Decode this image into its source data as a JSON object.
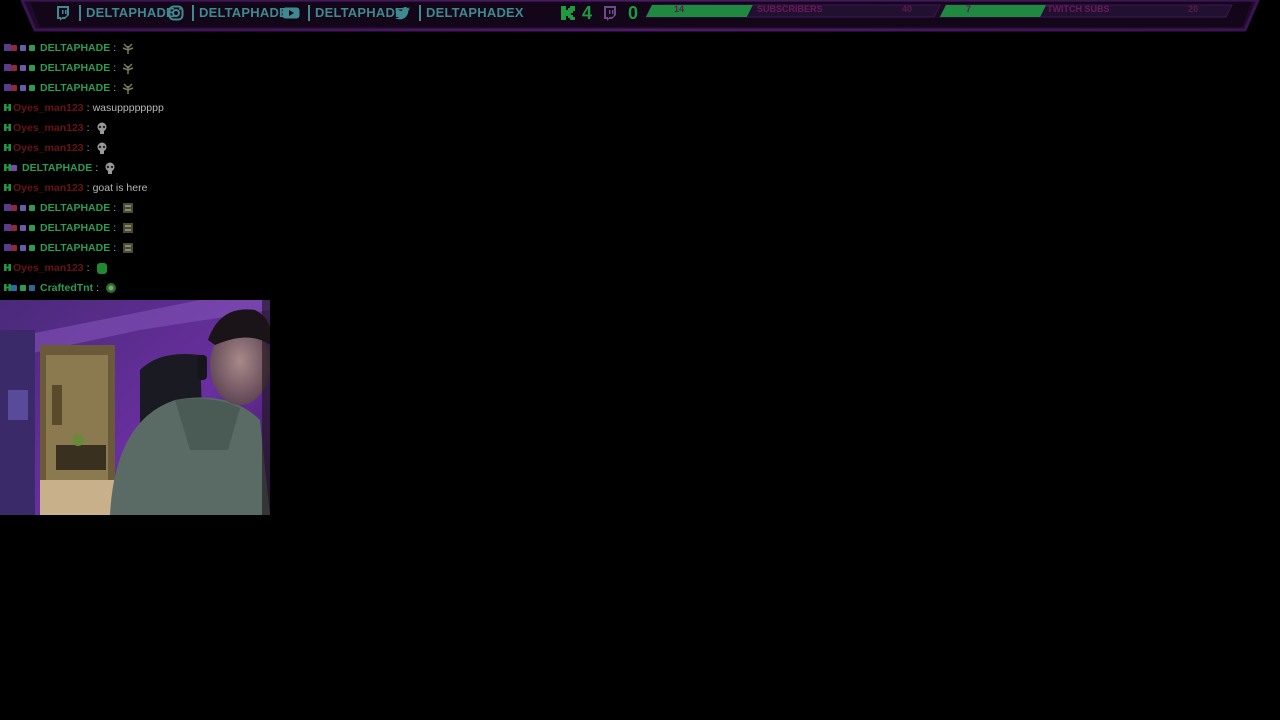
{
  "overlay": {
    "socials": [
      {
        "platform": "twitch",
        "icon": "twitch-icon",
        "handle": "DELTAPHADE"
      },
      {
        "platform": "instagram",
        "icon": "instagram-icon",
        "handle": "DELTAPHADE"
      },
      {
        "platform": "youtube",
        "icon": "youtube-icon",
        "handle": "DELTAPHADE"
      },
      {
        "platform": "twitter",
        "icon": "twitter-icon",
        "handle": "DELTAPHADEX"
      }
    ],
    "counters": [
      {
        "icon": "kick-icon",
        "value": "4"
      },
      {
        "icon": "twitch-icon",
        "value": "0"
      }
    ],
    "goals": [
      {
        "label": "SUBSCRIBERS",
        "current": "14",
        "target": "40",
        "fill": 0.35
      },
      {
        "label": "TWITCH SUBS",
        "current": "7",
        "target": "20",
        "fill": 0.35
      }
    ],
    "colors": {
      "accent_purple": "#5b1f7a",
      "social_text": "#3f8a8f",
      "bar_green": "#1f8a3f",
      "username_green": "#2d9b52",
      "username_red": "#6b1213"
    }
  },
  "chat": {
    "messages": [
      {
        "platform": "twitch",
        "user": "DELTAPHADE",
        "style": "delta",
        "text": "",
        "emote": "plant-emote"
      },
      {
        "platform": "twitch",
        "user": "DELTAPHADE",
        "style": "delta",
        "text": "",
        "emote": "plant-emote"
      },
      {
        "platform": "twitch",
        "user": "DELTAPHADE",
        "style": "delta",
        "text": "",
        "emote": "plant-emote"
      },
      {
        "platform": "kick",
        "user": "Oyes_man123",
        "style": "red",
        "text": "wasupppppppp",
        "emote": ""
      },
      {
        "platform": "kick",
        "user": "Oyes_man123",
        "style": "red",
        "text": "",
        "emote": "skull-emote"
      },
      {
        "platform": "kick",
        "user": "Oyes_man123",
        "style": "red",
        "text": "",
        "emote": "skull-emote"
      },
      {
        "platform": "kick",
        "user": "DELTAPHADE",
        "style": "delta",
        "text": "",
        "emote": "skull-emote"
      },
      {
        "platform": "kick",
        "user": "Oyes_man123",
        "style": "red",
        "text": "goat is here",
        "emote": ""
      },
      {
        "platform": "twitch",
        "user": "DELTAPHADE",
        "style": "delta",
        "text": "",
        "emote": "box-emote"
      },
      {
        "platform": "twitch",
        "user": "DELTAPHADE",
        "style": "delta",
        "text": "",
        "emote": "box-emote"
      },
      {
        "platform": "twitch",
        "user": "DELTAPHADE",
        "style": "delta",
        "text": "",
        "emote": "box-emote"
      },
      {
        "platform": "kick",
        "user": "Oyes_man123",
        "style": "red",
        "text": "",
        "emote": "green-emote"
      },
      {
        "platform": "kick",
        "user": "CraftedTnt",
        "style": "crafted",
        "text": "",
        "emote": "eye-emote"
      }
    ]
  },
  "webcam": {
    "icon": "webcam-feed"
  }
}
